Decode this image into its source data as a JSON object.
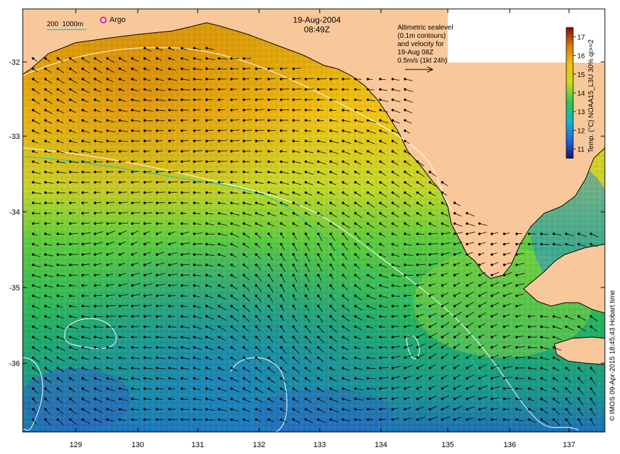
{
  "map": {
    "date": "19-Aug-2004",
    "time": "08:49Z",
    "legend_depth": "200  1000m",
    "argo_label": "Argo",
    "altimetry_note": [
      "Altimetric sealevel",
      "(0.1m contours)",
      "and velocity for",
      "19-Aug 08Z",
      "0.5m/s (1kt 24h)"
    ],
    "colorbar": {
      "label": "Temp. (°C) NOAA15_L3U 30% qi>=2",
      "ticks": [
        "11",
        "12",
        "13",
        "14",
        "15",
        "16",
        "17"
      ],
      "min": 10.5,
      "max": 17.5
    },
    "x_ticks": [
      "129",
      "130",
      "131",
      "132",
      "133",
      "134",
      "135",
      "136",
      "137"
    ],
    "y_ticks": [
      "-32",
      "-33",
      "-34",
      "-35",
      "-36"
    ],
    "credit": "© IMOS 09-Apr-2015 18:45:43 Hobart time",
    "colors": {
      "land": "#f9c89a",
      "contour": "#ffffff",
      "depth200": "#00c8c8",
      "argo": "#d000d0"
    }
  }
}
